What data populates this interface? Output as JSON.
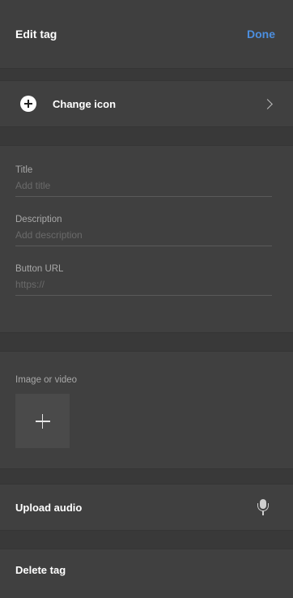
{
  "header": {
    "title": "Edit tag",
    "done_label": "Done"
  },
  "change_icon": {
    "label": "Change icon"
  },
  "fields": [
    {
      "label": "Title",
      "placeholder": "Add title",
      "value": ""
    },
    {
      "label": "Description",
      "placeholder": "Add description",
      "value": ""
    },
    {
      "label": "Button URL",
      "placeholder": "https://",
      "value": ""
    }
  ],
  "media": {
    "label": "Image or video"
  },
  "upload_audio": {
    "label": "Upload audio"
  },
  "delete_tag": {
    "label": "Delete tag"
  },
  "colors": {
    "accent": "#4c8fe0",
    "panel": "#404040",
    "divider": "#393939"
  }
}
